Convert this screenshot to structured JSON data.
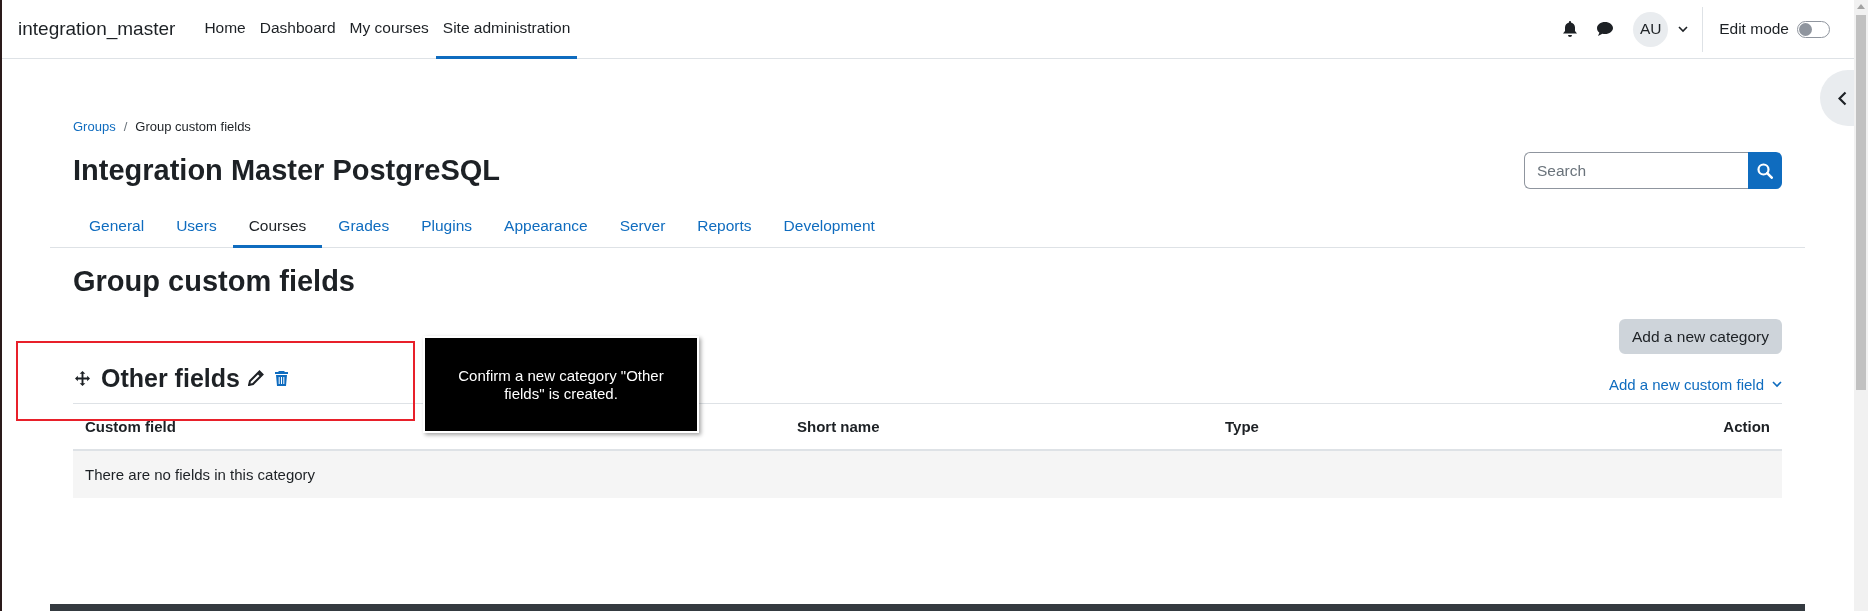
{
  "site_name": "integration_master",
  "primary_nav": [
    {
      "label": "Home",
      "selected": false
    },
    {
      "label": "Dashboard",
      "selected": false
    },
    {
      "label": "My courses",
      "selected": false
    },
    {
      "label": "Site administration",
      "selected": true
    }
  ],
  "user_menu": {
    "initials": "AU"
  },
  "edit_mode": {
    "label": "Edit mode",
    "on": false
  },
  "breadcrumb": [
    {
      "label": "Groups",
      "kind": "link"
    },
    {
      "label": "Group custom fields",
      "kind": "current"
    }
  ],
  "breadcrumb_separator": "/",
  "page_title": "Integration Master PostgreSQL",
  "search": {
    "placeholder": "Search"
  },
  "admin_tabs": [
    {
      "label": "General",
      "selected": false
    },
    {
      "label": "Users",
      "selected": false
    },
    {
      "label": "Courses",
      "selected": true
    },
    {
      "label": "Grades",
      "selected": false
    },
    {
      "label": "Plugins",
      "selected": false
    },
    {
      "label": "Appearance",
      "selected": false
    },
    {
      "label": "Server",
      "selected": false
    },
    {
      "label": "Reports",
      "selected": false
    },
    {
      "label": "Development",
      "selected": false
    }
  ],
  "heading": "Group custom fields",
  "add_category_button": "Add a new category",
  "category": {
    "name": "Other fields",
    "add_field_link": "Add a new custom field",
    "table": {
      "columns": [
        "Custom field",
        "Short name",
        "Type",
        "Action"
      ],
      "empty_message": "There are no fields in this category"
    }
  },
  "annotation": {
    "text": "Confirm a new category \"Other fields\" is created."
  }
}
